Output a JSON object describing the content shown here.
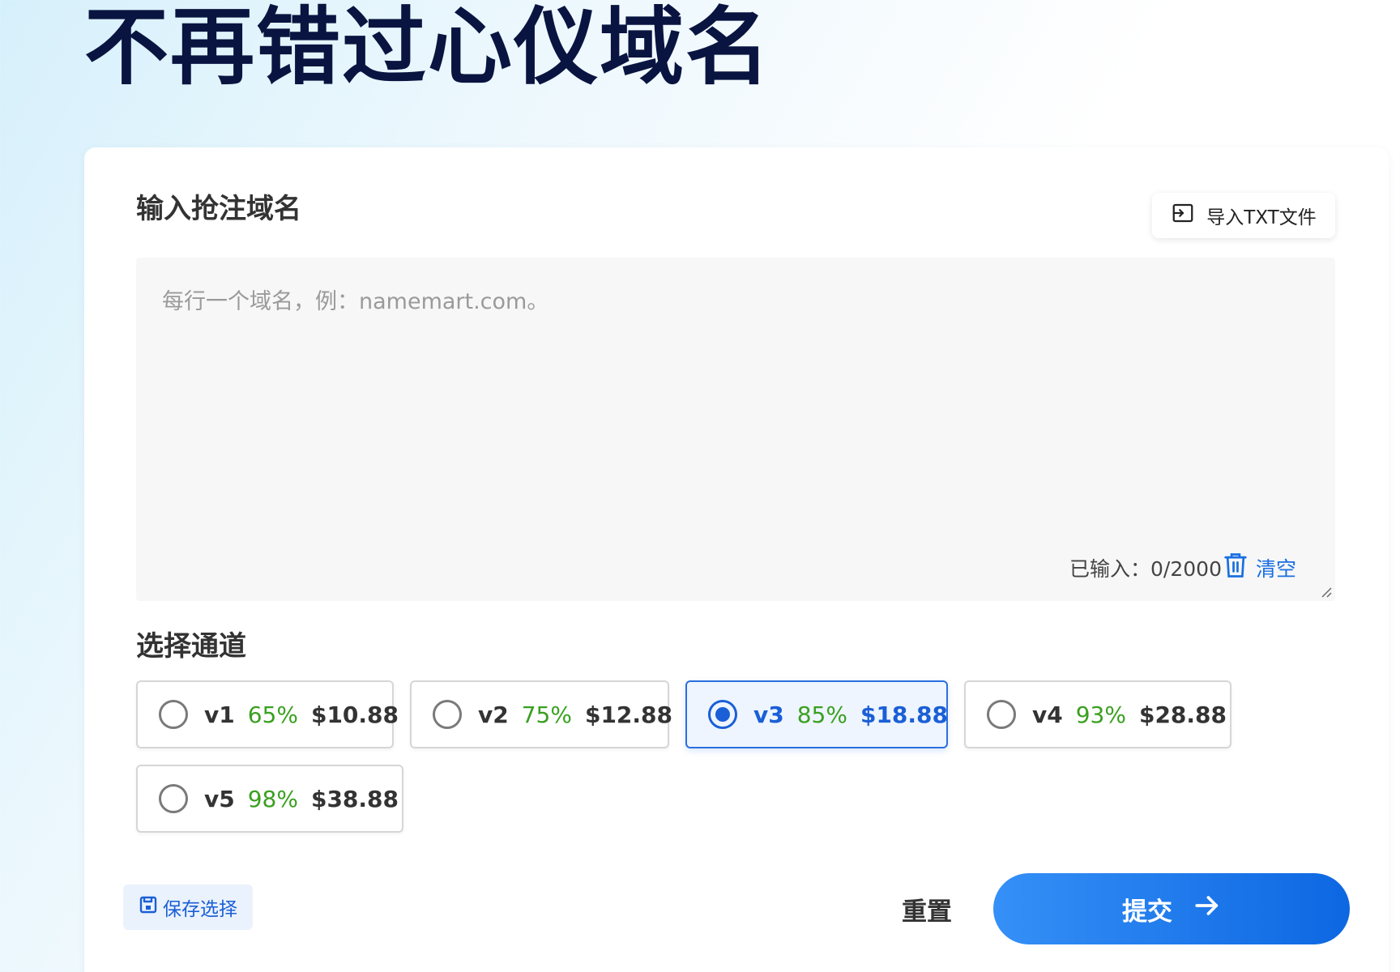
{
  "hero": {
    "title": "不再错过心仪域名"
  },
  "input_section": {
    "title": "输入抢注域名",
    "import_label": "导入TXT文件",
    "placeholder": "每行一个域名，例：namemart.com。",
    "counter_label": "已输入：0/2000",
    "clear_label": "清空"
  },
  "channel_section": {
    "title": "选择通道",
    "options": [
      {
        "name": "v1",
        "rate": "65%",
        "price": "$10.88",
        "selected": false
      },
      {
        "name": "v2",
        "rate": "75%",
        "price": "$12.88",
        "selected": false
      },
      {
        "name": "v3",
        "rate": "85%",
        "price": "$18.88",
        "selected": true
      },
      {
        "name": "v4",
        "rate": "93%",
        "price": "$28.88",
        "selected": false
      },
      {
        "name": "v5",
        "rate": "98%",
        "price": "$38.88",
        "selected": false
      }
    ]
  },
  "actions": {
    "save_label": "保存选择",
    "reset_label": "重置",
    "submit_label": "提交"
  },
  "colors": {
    "accent": "#1a5fd6",
    "rate_green": "#3aa020",
    "title_navy": "#0a1440"
  }
}
